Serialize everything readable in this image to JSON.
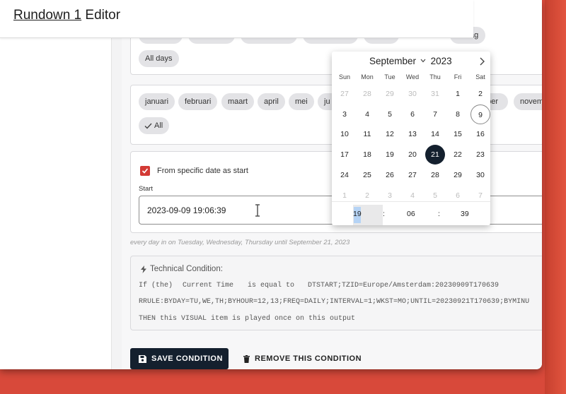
{
  "window": {
    "title_link": "Rundown 1",
    "title_rest": " Editor"
  },
  "weekdays_card": {
    "ghost_chips": [
      "",
      "",
      "",
      "",
      "",
      "ag"
    ],
    "all_days_chip": "All days"
  },
  "months_card": {
    "chips": [
      "januari",
      "februari",
      "maart",
      "april",
      "mei",
      "ju",
      "ober",
      "novem"
    ],
    "all_chip": "All"
  },
  "start_card": {
    "checkbox_label": "From specific date as start",
    "checked": true,
    "start_label": "Start",
    "start_value": "2023-09-09 19:06:39"
  },
  "summary_text": "every day in on Tuesday, Wednesday, Thursday until September 21, 2023",
  "technical": {
    "heading": "Technical Condition:",
    "line1_if": "If (the)",
    "line1_subject": "Current Time",
    "line1_op": "is equal to",
    "line1_value": "DTSTART;TZID=Europe/Amsterdam:20230909T170639",
    "line2": "RRULE:BYDAY=TU,WE,TH;BYHOUR=12,13;FREQ=DAILY;INTERVAL=1;WKST=MO;UNTIL=20230921T170639;BYMINU",
    "line3": "THEN this VISUAL item is played once on this output"
  },
  "buttons": {
    "save": "SAVE CONDITION",
    "remove": "REMOVE THIS CONDITION"
  },
  "datepicker": {
    "month": "September",
    "year": "2023",
    "weekdays": [
      "Sun",
      "Mon",
      "Tue",
      "Wed",
      "Thu",
      "Fri",
      "Sat"
    ],
    "weeks": [
      [
        "27",
        "28",
        "29",
        "30",
        "31",
        "1",
        "2"
      ],
      [
        "3",
        "4",
        "5",
        "6",
        "7",
        "8",
        "9"
      ],
      [
        "10",
        "11",
        "12",
        "13",
        "14",
        "15",
        "16"
      ],
      [
        "17",
        "18",
        "19",
        "20",
        "21",
        "22",
        "23"
      ],
      [
        "24",
        "25",
        "26",
        "27",
        "28",
        "29",
        "30"
      ],
      [
        "1",
        "2",
        "3",
        "4",
        "5",
        "6",
        "7"
      ]
    ],
    "today": "9",
    "selected": "21",
    "time": {
      "hours": "19",
      "sep1": ":",
      "minutes": "06",
      "sep2": ":",
      "seconds": "39"
    }
  },
  "colors": {
    "accent": "#d33a35",
    "selected_day": "#14202e",
    "background": "#d8493a",
    "primary_button": "#14202e"
  }
}
